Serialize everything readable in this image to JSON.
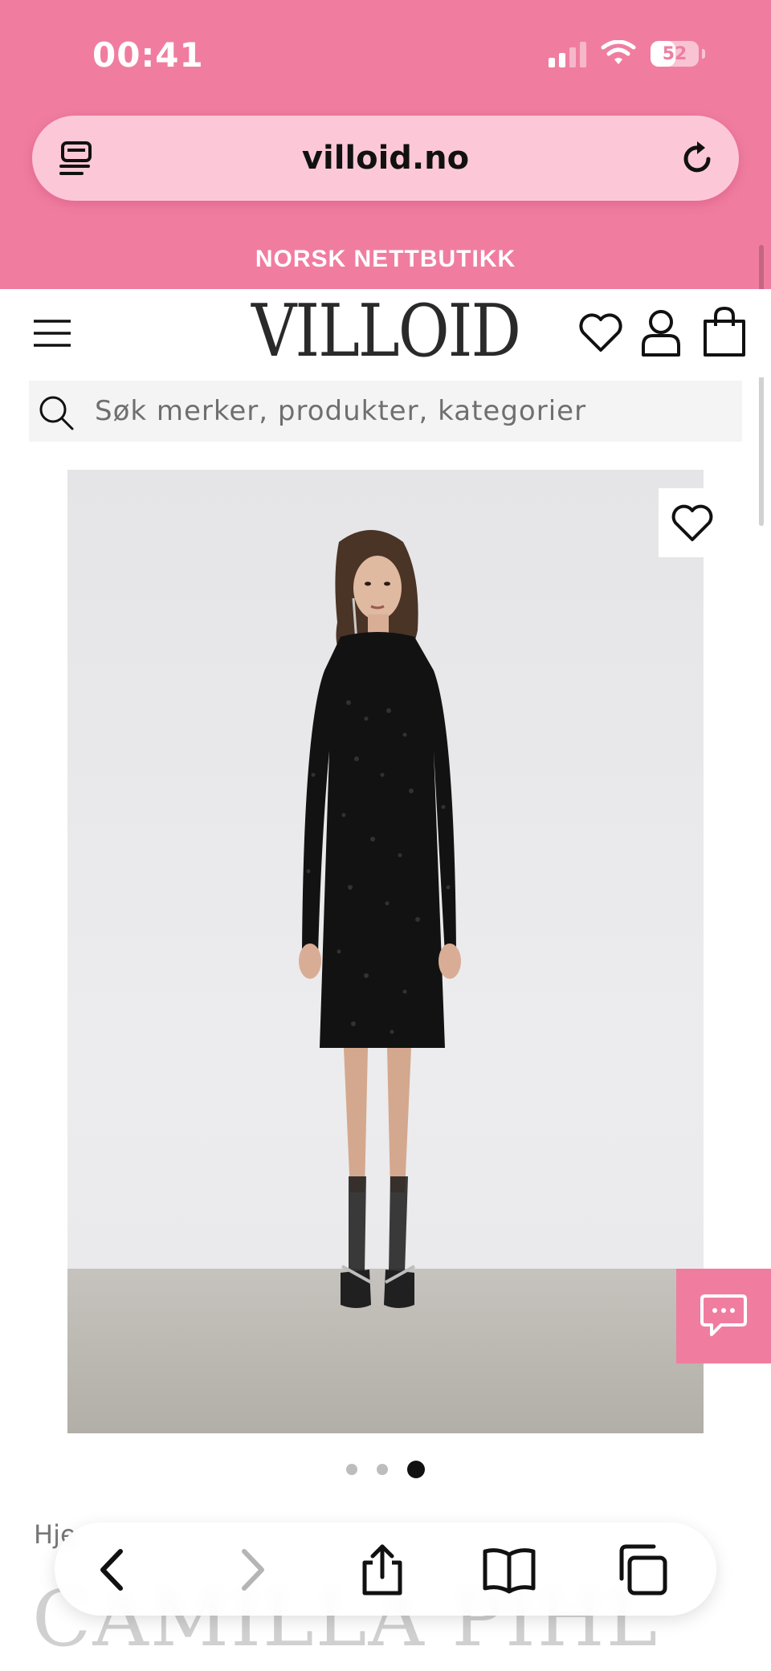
{
  "status_bar": {
    "time": "00:41",
    "battery": "52",
    "icons": [
      "cellular-signal-icon",
      "wifi-icon",
      "battery-icon"
    ]
  },
  "browser": {
    "url": "villoid.no",
    "toolbar_icons": [
      "reader-icon",
      "reload-icon",
      "back-icon",
      "forward-icon",
      "share-icon",
      "bookmarks-icon",
      "tabs-icon"
    ]
  },
  "announcement": {
    "text": "NORSK NETTBUTIKK"
  },
  "header": {
    "logo": "VILLOID",
    "icons": [
      "menu-icon",
      "wishlist-icon",
      "account-icon",
      "bag-icon"
    ]
  },
  "search": {
    "placeholder": "Søk merker, produkter, kategorier"
  },
  "product": {
    "breadcrumb": "Hje",
    "brand": "CAMILLA PIHL",
    "gallery": {
      "total_images": 3,
      "active_index": 3
    }
  },
  "colors": {
    "brand_pink": "#f07da0",
    "url_bar_pink": "#fcc8d8",
    "text_dark": "#111111"
  }
}
